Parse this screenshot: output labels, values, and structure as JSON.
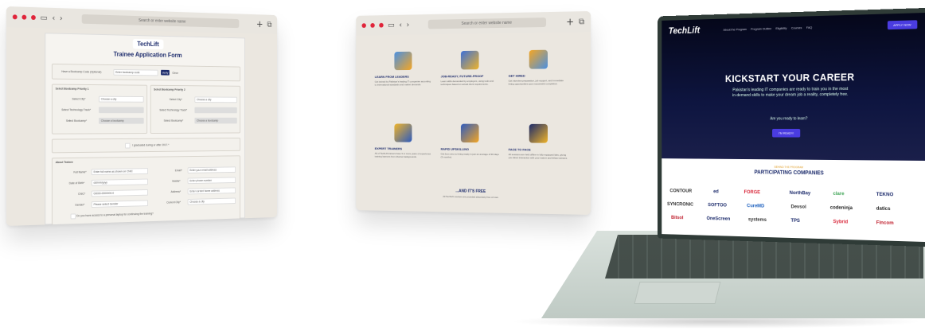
{
  "form_window": {
    "url_placeholder": "Search or enter website name",
    "logo": "TechLift",
    "title": "Trainee Application Form",
    "invite_label": "Have a Bootcamp Code (Optional)",
    "invite_placeholder": "Enter bootcamp code",
    "verify_label": "Verify",
    "clear_label": "Clear",
    "priority1_title": "Select Bootcamp Priority 1",
    "priority2_title": "Select Bootcamp Priority 2",
    "city_label": "Select City*",
    "city_placeholder": "Choose a city",
    "tech_label": "Select Technology Track*",
    "bootcamp_label": "Select Bootcamp*",
    "bootcamp_placeholder": "Choose a bootcamp",
    "graduated_label": "I graduated during or after 2017.*",
    "about_title": "About Trainee",
    "fullname_label": "Full Name*",
    "fullname_placeholder": "Enter full name as shown on CNIC",
    "email_label": "Email*",
    "email_placeholder": "Enter your email address",
    "dob_label": "Date of Birth*",
    "dob_placeholder": "dd/mm/yyyy",
    "mobile_label": "Mobile*",
    "mobile_placeholder": "Enter phone number",
    "cnic_label": "CNIC*",
    "cnic_placeholder": "00000-0000000-0",
    "address_label": "Address*",
    "address_placeholder": "Enter current home address",
    "gender_label": "Gender*",
    "gender_placeholder": "Please select Gender",
    "current_city_label": "Current City*",
    "current_city_placeholder": "Choose a city",
    "laptop_check": "Do you have access to a personal laptop for continuing the training?"
  },
  "features_window": {
    "url_placeholder": "Search or enter website name",
    "features": [
      {
        "title": "LEARN FROM LEADERS",
        "text": "Get trained by Pakistan's leading IT companies according to international standards and market demands."
      },
      {
        "title": "JOB-READY, FUTURE-PROOF",
        "text": "Learn skills demanded by employers, using tools and techniques based on actual client requirements."
      },
      {
        "title": "GET HIRED",
        "text": "Get interview preparation, job support, and immediate hiring opportunities upon successful completion."
      },
      {
        "title": "EXPERT TRAINERS",
        "text": "All of TechLift trainers have 3 or more years of experience training learners from diverse backgrounds."
      },
      {
        "title": "RAPID UPSKILLING",
        "text": "Get from zero to hiring-ready in just an average of 90 days (3 months)."
      },
      {
        "title": "FACE TO FACE",
        "text": "All sessions are held offline in fully equipped labs, giving you direct interaction with your trainer and fellow trainees."
      }
    ],
    "free_title": "...AND IT'S FREE",
    "free_text": "All TechLift courses are provided absolutely free of cost."
  },
  "laptop": {
    "brand": "TechLift",
    "nav": [
      "About the Program",
      "Program Outline",
      "Eligibility",
      "Courses",
      "FAQ"
    ],
    "apply_label": "APPLY NOW",
    "hero_title": "KICKSTART YOUR CAREER",
    "hero_text": "Pakistan's leading IT companies are ready to train you in the most in-demand skills to make your dream job a reality, completely free.",
    "hero_question": "Are you ready to learn?",
    "cta_label": "I'M READY!",
    "partners_kicker": "BEHIND THE PROGRAM",
    "partners_title": "PARTICIPATING COMPANIES",
    "companies": [
      "CONTOUR",
      "ed",
      "FORGE",
      "NorthBay",
      "clare",
      "TEKNO",
      "SYNCRONIC",
      "SOFTOO",
      "CureMD",
      "Devsol",
      "codeninja",
      "datics",
      "Bitsol",
      "OneScreen",
      "systems",
      "TPS",
      "Sybrid",
      "Fincom"
    ]
  }
}
